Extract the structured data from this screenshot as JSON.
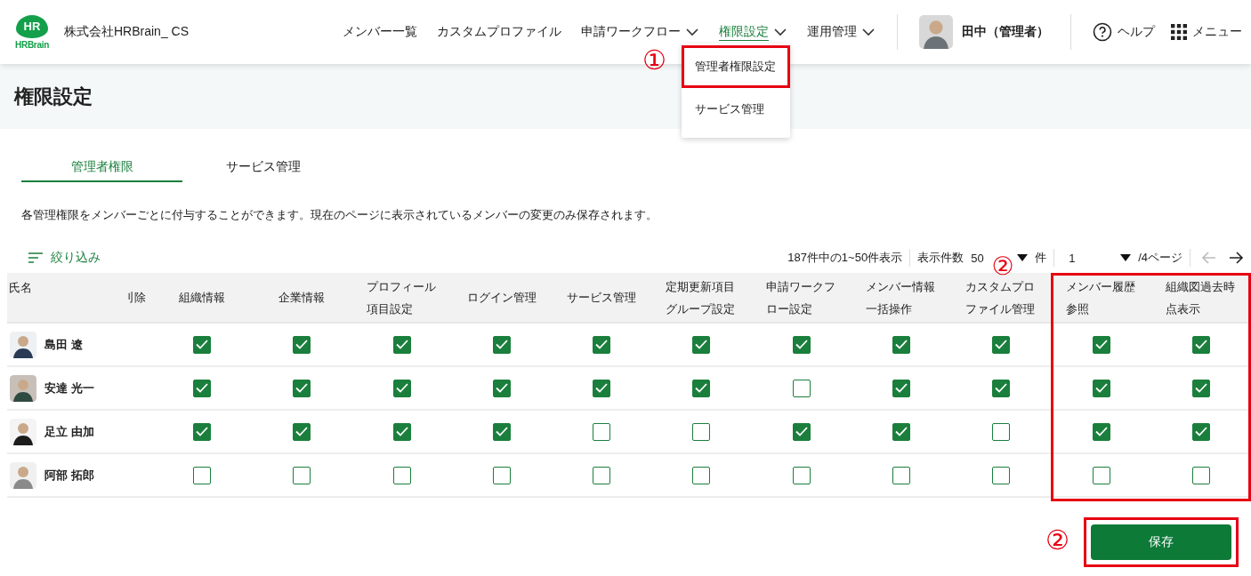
{
  "header": {
    "logo_badge": "HR",
    "logo_word": "HRBrain",
    "company": "株式会社HRBrain_ CS",
    "nav": [
      {
        "label": "メンバー一覧",
        "has_menu": false,
        "selected": false
      },
      {
        "label": "カスタムプロファイル",
        "has_menu": false,
        "selected": false
      },
      {
        "label": "申請ワークフロー",
        "has_menu": true,
        "selected": false
      },
      {
        "label": "権限設定",
        "has_menu": true,
        "selected": true
      },
      {
        "label": "運用管理",
        "has_menu": true,
        "selected": false
      }
    ],
    "user": "田中（管理者）",
    "help": "ヘルプ",
    "menu": "メニュー"
  },
  "dropdown": {
    "items": [
      {
        "label": "管理者権限設定",
        "highlighted": true,
        "marker": "①"
      },
      {
        "label": "サービス管理",
        "highlighted": false
      }
    ]
  },
  "page_title": "権限設定",
  "tabs": [
    {
      "label": "管理者権限",
      "selected": true
    },
    {
      "label": "サービス管理",
      "selected": false
    }
  ],
  "description": "各管理権限をメンバーごとに付与することができます。現在のページに表示されているメンバーの変更のみ保存されます。",
  "filter_label": "絞り込み",
  "pagination": {
    "summary": "187件中の1~50件表示",
    "per_page_label": "表示件数",
    "per_page": "50",
    "per_page_unit": "件",
    "page": "1",
    "page_total": "/4ページ",
    "prev_disabled": true
  },
  "table": {
    "columns": [
      {
        "label": "氏名"
      },
      {
        "label": "刂除"
      },
      {
        "label": "組織情報"
      },
      {
        "label": "企業情報"
      },
      {
        "label": "プロフィール項目設定"
      },
      {
        "label": "ログイン管理"
      },
      {
        "label": "サービス管理"
      },
      {
        "label": "定期更新項目グループ設定"
      },
      {
        "label": "申請ワークフロー設定"
      },
      {
        "label": "メンバー情報一括操作"
      },
      {
        "label": "カスタムプロファイル管理"
      },
      {
        "label": "メンバー履歴参照",
        "highlighted": true,
        "marker": "②"
      },
      {
        "label": "組織図過去時点表示"
      }
    ],
    "rows": [
      {
        "name": "島田 遼",
        "permissions": [
          true,
          true,
          true,
          true,
          true,
          true,
          true,
          true,
          true,
          true,
          true
        ]
      },
      {
        "name": "安達 光一",
        "permissions": [
          true,
          true,
          true,
          true,
          true,
          true,
          false,
          true,
          true,
          true,
          true
        ]
      },
      {
        "name": "足立 由加",
        "permissions": [
          true,
          true,
          true,
          true,
          false,
          false,
          true,
          true,
          false,
          true,
          true
        ]
      },
      {
        "name": "阿部 拓郎",
        "permissions": [
          false,
          false,
          false,
          false,
          false,
          false,
          false,
          false,
          false,
          false,
          false
        ]
      }
    ]
  },
  "save": {
    "label": "保存",
    "highlighted": true,
    "marker": "②"
  }
}
